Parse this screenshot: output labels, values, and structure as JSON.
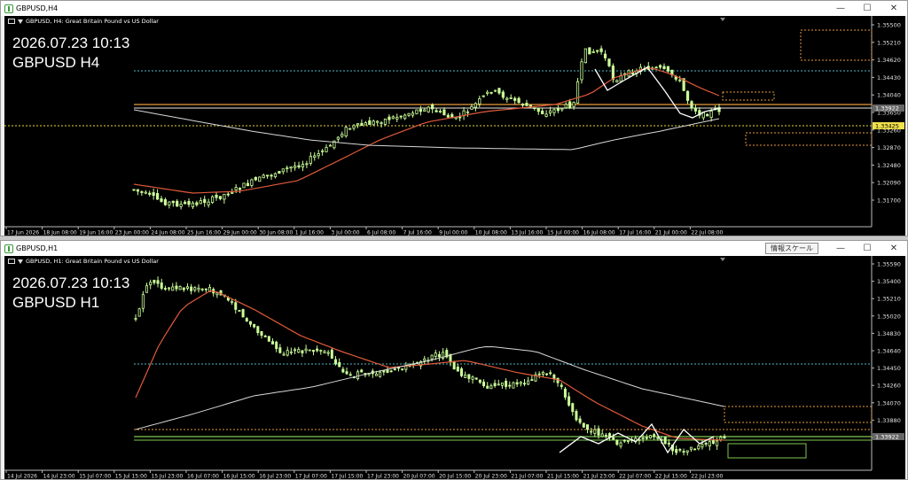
{
  "windows": [
    {
      "title": "GBPUSD,H4",
      "header": "GBPUSD, H4:  Great Britain Pound vs US Dollar",
      "overlay_time": "2026.07.23 10:13",
      "overlay_symbol": "GBPUSD H4",
      "price_labels": [
        "1.35500",
        "1.35210",
        "1.34620",
        "1.34430",
        "1.34040",
        "1.33650",
        "1.33260",
        "1.32870",
        "1.32480",
        "1.32090",
        "1.31700"
      ],
      "current_price": "1.33922",
      "bid_price": "1.33425",
      "time_labels": [
        "17 Jun 2026",
        "18 Jun 08:00",
        "19 Jun 16:00",
        "23 Jun 00:00",
        "24 Jun 08:00",
        "25 Jun 16:00",
        "29 Jun 00:00",
        "30 Jun 08:00",
        "1 Jul 16:00",
        "3 Jul 00:00",
        "6 Jul 08:00",
        "7 Jul 16:00",
        "9 Jul 00:00",
        "10 Jul 08:00",
        "13 Jul 16:00",
        "15 Jul 00:00",
        "16 Jul 08:00",
        "17 Jul 16:00",
        "21 Jul 00:00",
        "22 Jul 08:00"
      ]
    },
    {
      "title": "GBPUSD,H1",
      "header": "GBPUSD, H1:  Great Britain Pound vs US Dollar",
      "overlay_time": "2026.07.23 10:13",
      "overlay_symbol": "GBPUSD H1",
      "price_labels": [
        "1.35590",
        "1.35400",
        "1.35210",
        "1.35020",
        "1.34830",
        "1.34640",
        "1.34450",
        "1.34260",
        "1.34070",
        "1.33880",
        "1.33690"
      ],
      "current_price": "1.33922",
      "time_labels": [
        "14 Jul 2026",
        "14 Jul 23:00",
        "15 Jul 07:00",
        "15 Jul 15:00",
        "15 Jul 23:00",
        "16 Jul 07:00",
        "16 Jul 15:00",
        "16 Jul 23:00",
        "17 Jul 07:00",
        "17 Jul 15:00",
        "17 Jul 23:00",
        "20 Jul 07:00",
        "20 Jul 15:00",
        "20 Jul 23:00",
        "21 Jul 07:00",
        "21 Jul 15:00",
        "21 Jul 23:00",
        "22 Jul 07:00",
        "22 Jul 15:00",
        "22 Jul 23:00"
      ],
      "scale_button": "情報スケール"
    }
  ],
  "colors": {
    "candle": "#ccff99",
    "ma_fast": "#e05a3a",
    "ma_slow": "#d8d8d8",
    "level_orange": "#e89a3a",
    "level_white": "#e8e8e8",
    "level_cyan": "#4fb8c8",
    "level_yellow": "#e8d83a",
    "level_green": "#7ec850",
    "bid_box": "#f0e04a"
  }
}
